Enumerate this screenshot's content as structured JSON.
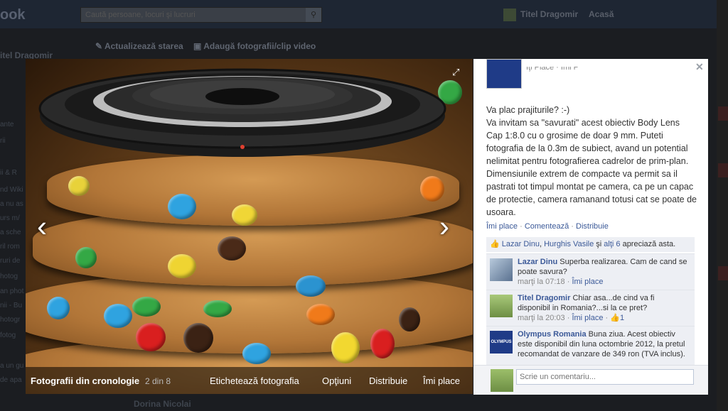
{
  "background": {
    "logo": "ook",
    "search_placeholder": "Caută persoane, locuri şi lucruri",
    "user_name": "Titel Dragomir",
    "home_label": "Acasă",
    "profile_name": "itel Dragomir",
    "update_status": "Actualizează starea",
    "add_photos": "Adaugă fotografii/clip video",
    "sidebar_fragments": [
      "ante",
      "rii",
      "ii & R",
      "nd Wiki",
      "a nu as",
      "urs m/",
      "a sche",
      "ril rom",
      "ruri de",
      "hotog",
      "an phot",
      "nii - Bu",
      "hotogr",
      "fotog",
      "a un gu",
      "de apa",
      "i locuri"
    ],
    "bottom_name": "Dorina Nicolai"
  },
  "viewer": {
    "album_title": "Fotografii din cronologie",
    "counter": "2 din 8",
    "tag_photo": "Etichetează fotografia",
    "options": "Opţiuni",
    "share": "Distribuie",
    "like": "Îmi place"
  },
  "post": {
    "meta_cropped": "Îţi Place · Îmi P",
    "line1": "Va plac prajiturile? :-)",
    "body": "Va invitam sa \"savurati\" acest obiectiv Body Lens Cap 1:8.0 cu o grosime de doar 9 mm. Puteti fotografia de la 0.3m de subiect, avand un potential nelimitat pentru fotografierea cadrelor de prim-plan. Dimensiunile extrem de compacte va permit sa il pastrati tot timpul montat pe camera, ca pe un capac de protectie, camera ramanand totusi cat se poate de usoara.",
    "actions": {
      "like": "Îmi place",
      "comment": "Comentează",
      "share": "Distribuie",
      "sep": "·"
    },
    "likes": {
      "names": "Lazar Dinu",
      "sep": ", ",
      "names2": "Hurghis Vasile",
      "and": " şi ",
      "others": "alţi 6",
      "suffix": " apreciază asta."
    }
  },
  "comments": [
    {
      "author": "Lazar Dinu",
      "text": "Superba realizarea. Cam de cand se poate savura?",
      "time": "marţi la 07:18",
      "like": "Îmi place",
      "sep": " · "
    },
    {
      "author": "Titel Dragomir",
      "text": "Chiar asa...de cind va fi disponibil in Romania?...si la ce pret?",
      "time": "marţi la 20:03",
      "like": "Îmi place",
      "sep": " · ",
      "count": "1"
    },
    {
      "author": "Olympus Romania",
      "text": "Buna ziua. Acest obiectiv este disponibil din luna octombrie 2012, la pretul recomandat de vanzare de 349 ron (TVA inclus).",
      "avatar_text": "OLYMPUS"
    }
  ],
  "reply": {
    "placeholder": "Scrie un comentariu..."
  },
  "colors": {
    "link": "#3b5998",
    "panel_bg": "#ffffff",
    "comment_bg": "#edeff4"
  }
}
